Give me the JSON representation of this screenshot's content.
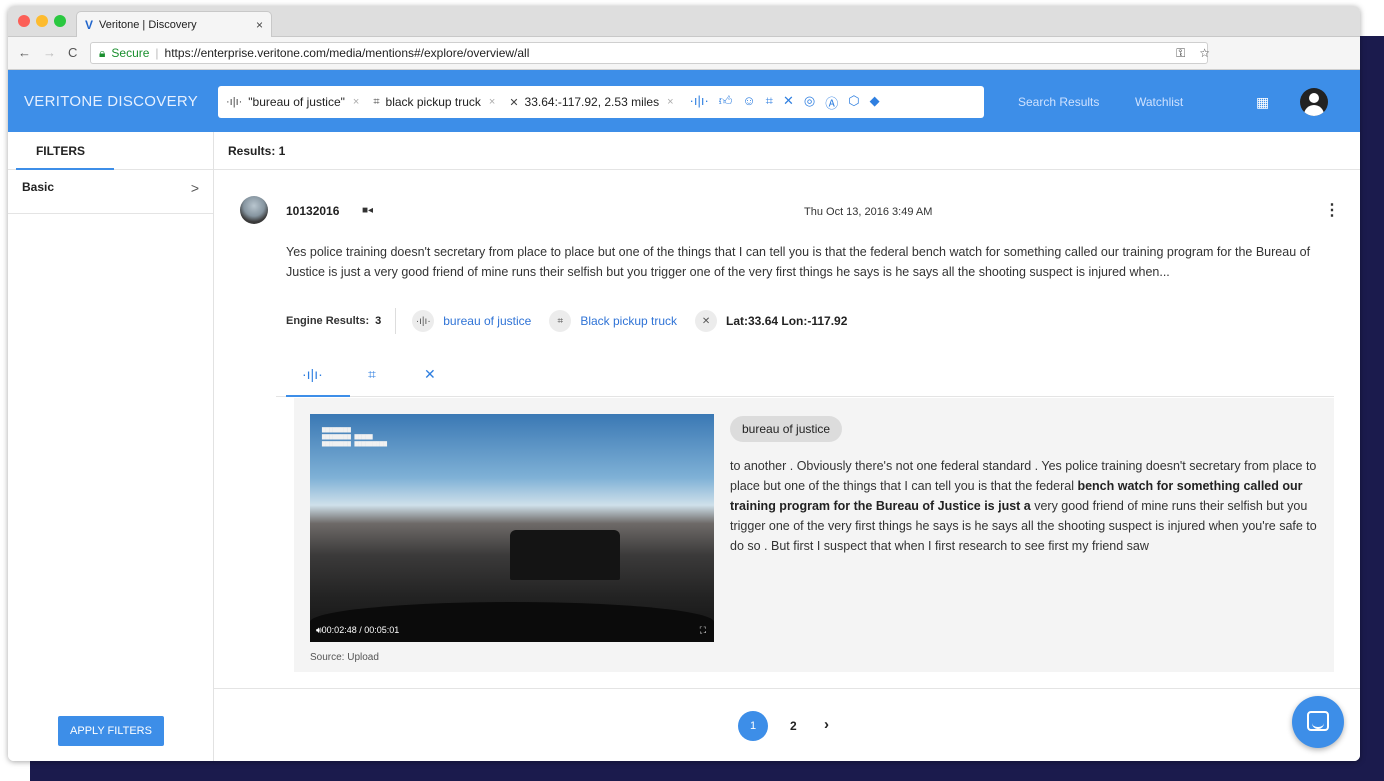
{
  "browser": {
    "tab_title": "Veritone | Discovery",
    "tab_close": "×",
    "secure_label": "Secure",
    "url": "https://enterprise.veritone.com/media/mentions#/explore/overview/all",
    "nav_back": "←",
    "nav_forward": "→",
    "nav_reload": "C"
  },
  "header": {
    "brand": "VERITONE DISCOVERY",
    "chips": [
      {
        "icon": "audio-wave-icon",
        "glyph": "·ı|ı·",
        "label": "\"bureau of justice\"",
        "close": "×"
      },
      {
        "icon": "object-detect-icon",
        "glyph": "⌗",
        "label": "black pickup truck",
        "close": "×"
      },
      {
        "icon": "satellite-icon",
        "glyph": "✕",
        "label": "33.64:-117.92, 2.53 miles",
        "close": "×"
      }
    ],
    "search_results": "Search Results",
    "watchlist": "Watchlist"
  },
  "sidebar": {
    "filters_tab": "FILTERS",
    "basic": "Basic",
    "basic_chevron": ">",
    "apply": "APPLY FILTERS"
  },
  "main": {
    "results": "Results: 1",
    "item": {
      "title": "10132016",
      "date": "Thu Oct 13, 2016 3:49 AM",
      "snippet": "Yes police training doesn't secretary from place to place but one of the things that I can tell you is that the federal bench watch for something called our training program for the Bureau of Justice is just a very good friend of mine runs their selfish but you trigger one of the very first things he says is he says all the shooting suspect is injured when...",
      "engine_results_label": "Engine Results:",
      "engine_results_count": "3",
      "engine_results": [
        {
          "icon": "audio-wave-icon",
          "label": "bureau of justice"
        },
        {
          "icon": "object-detect-icon",
          "label": "Black pickup truck"
        },
        {
          "icon": "satellite-icon",
          "label": "Lat:33.64 Lon:-117.92"
        }
      ]
    },
    "detail": {
      "video_time": "00:02:48 / 00:05:01",
      "source": "Source: Upload",
      "tag": "bureau of justice",
      "transcript_pre": "to another . Obviously there's not one federal standard . Yes police training doesn't secretary from place to place but one of the things that I can tell you is that the federal ",
      "transcript_bold": "bench watch for something called our training program for the Bureau of Justice is just a",
      "transcript_post": " very good friend of mine runs their selfish but you trigger one of the very first things he says is he says all the shooting suspect is injured when you're safe to do so . But first I suspect that when I first research to see first my friend saw"
    },
    "pagination": {
      "current": "1",
      "next_page": "2",
      "next": "›"
    }
  },
  "colors": {
    "accent": "#3d8ee8",
    "link": "#2f73d6",
    "backdrop": "#1b1b4d"
  }
}
